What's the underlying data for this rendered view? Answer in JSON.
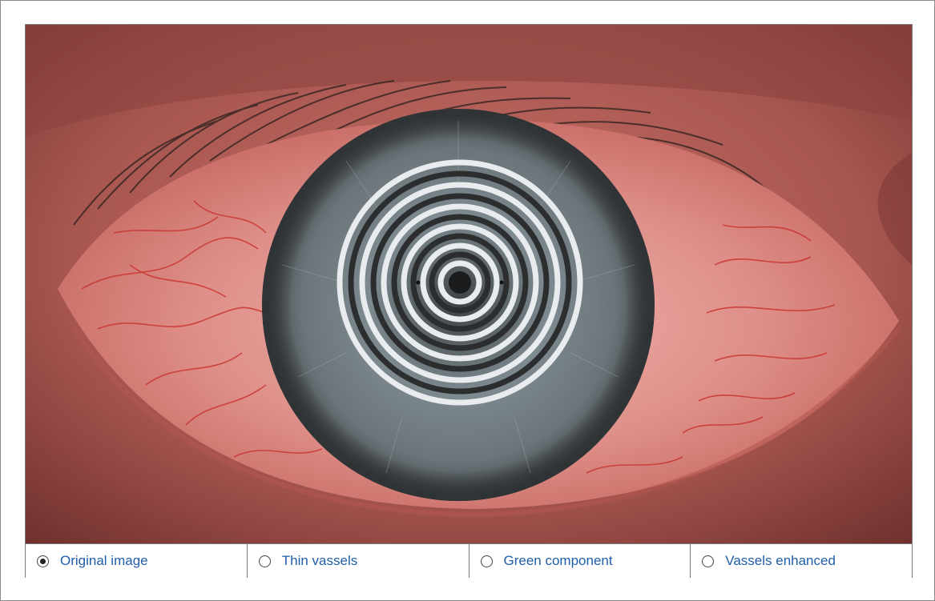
{
  "viewer": {
    "image_description_icon": "eye-photograph",
    "options": [
      {
        "label": "Original image",
        "selected": true
      },
      {
        "label": "Thin vassels",
        "selected": false
      },
      {
        "label": "Green component",
        "selected": false
      },
      {
        "label": "Vassels enhanced",
        "selected": false
      }
    ]
  },
  "colors": {
    "label": "#1f5ea8",
    "border": "#7a7a7a",
    "sclera": "#d98a86",
    "iris": "#6f7d83"
  }
}
